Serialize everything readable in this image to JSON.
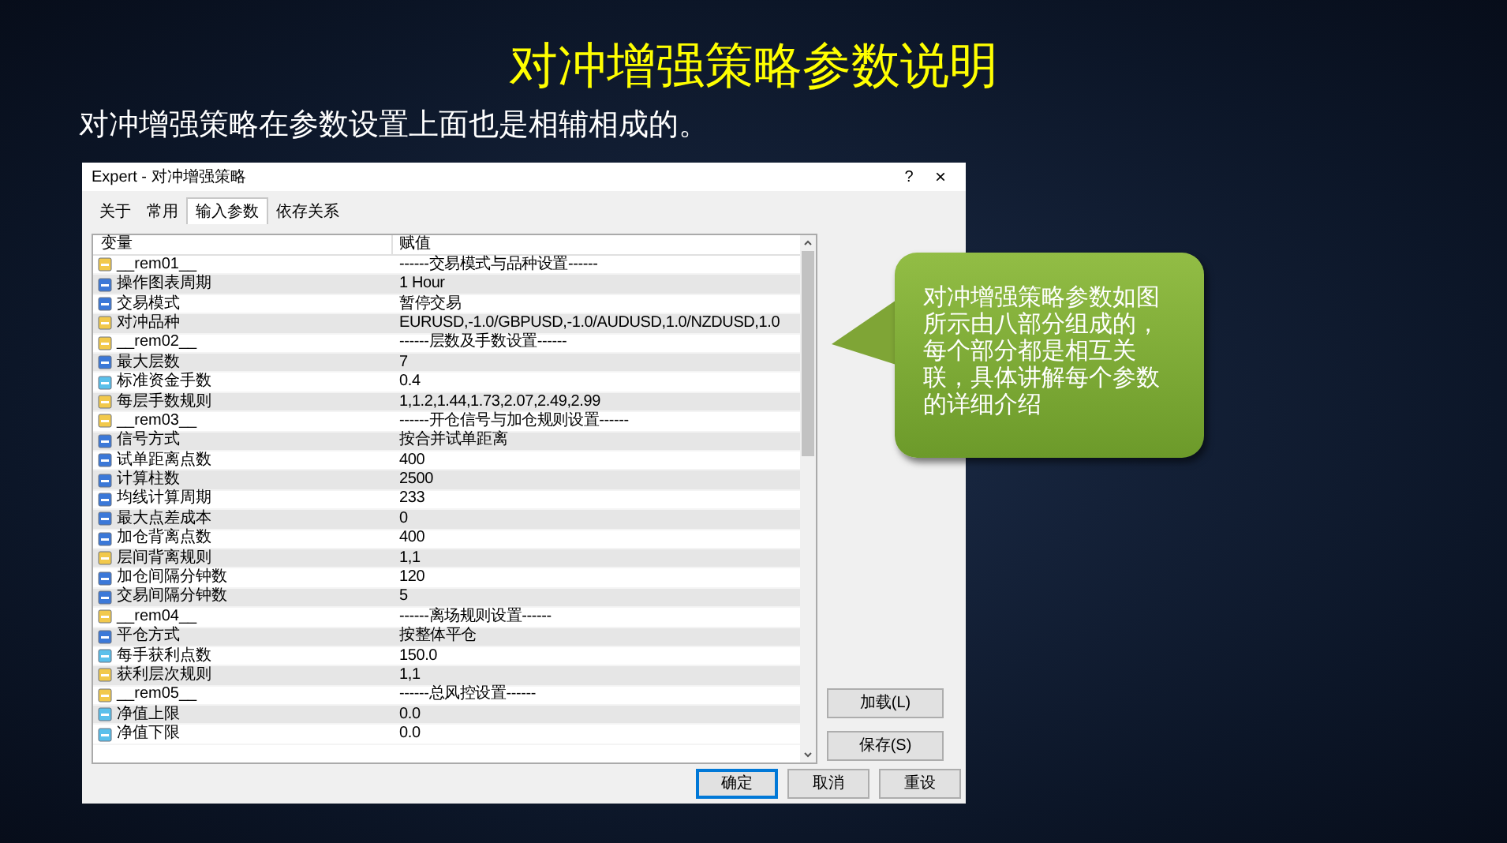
{
  "slide": {
    "title": "对冲增强策略参数说明",
    "subtitle": "对冲增强策略在参数设置上面也是相辅相成的。"
  },
  "dialog": {
    "title": "Expert - 对冲增强策略",
    "help": "?",
    "close": "×",
    "tabs": [
      {
        "label": "关于",
        "selected": false
      },
      {
        "label": "常用",
        "selected": false
      },
      {
        "label": "输入参数",
        "selected": true
      },
      {
        "label": "依存关系",
        "selected": false
      }
    ],
    "table": {
      "columns": [
        "变量",
        "赋值"
      ],
      "rows": [
        {
          "kind": "string",
          "name": "__rem01__",
          "value": "------交易模式与品种设置------"
        },
        {
          "kind": "int",
          "name": "操作图表周期",
          "value": "1 Hour"
        },
        {
          "kind": "int",
          "name": "交易模式",
          "value": "暂停交易"
        },
        {
          "kind": "string",
          "name": "对冲品种",
          "value": "EURUSD,-1.0/GBPUSD,-1.0/AUDUSD,1.0/NZDUSD,1.0"
        },
        {
          "kind": "string",
          "name": "__rem02__",
          "value": "------层数及手数设置------"
        },
        {
          "kind": "int",
          "name": "最大层数",
          "value": "7"
        },
        {
          "kind": "double",
          "name": "标准资金手数",
          "value": "0.4"
        },
        {
          "kind": "string",
          "name": "每层手数规则",
          "value": "1,1.2,1.44,1.73,2.07,2.49,2.99"
        },
        {
          "kind": "string",
          "name": "__rem03__",
          "value": "------开仓信号与加仓规则设置------"
        },
        {
          "kind": "int",
          "name": "信号方式",
          "value": "按合并试单距离"
        },
        {
          "kind": "int",
          "name": "试单距离点数",
          "value": "400"
        },
        {
          "kind": "int",
          "name": "计算柱数",
          "value": "2500"
        },
        {
          "kind": "int",
          "name": "均线计算周期",
          "value": "233"
        },
        {
          "kind": "int",
          "name": "最大点差成本",
          "value": "0"
        },
        {
          "kind": "int",
          "name": "加仓背离点数",
          "value": "400"
        },
        {
          "kind": "string",
          "name": "层间背离规则",
          "value": "1,1"
        },
        {
          "kind": "int",
          "name": "加仓间隔分钟数",
          "value": "120"
        },
        {
          "kind": "int",
          "name": "交易间隔分钟数",
          "value": "5"
        },
        {
          "kind": "string",
          "name": "__rem04__",
          "value": "------离场规则设置------"
        },
        {
          "kind": "int",
          "name": "平仓方式",
          "value": "按整体平仓"
        },
        {
          "kind": "double",
          "name": "每手获利点数",
          "value": "150.0"
        },
        {
          "kind": "string",
          "name": "获利层次规则",
          "value": "1,1"
        },
        {
          "kind": "string",
          "name": "__rem05__",
          "value": "------总风控设置------"
        },
        {
          "kind": "double",
          "name": "净值上限",
          "value": "0.0"
        },
        {
          "kind": "double",
          "name": "净值下限",
          "value": "0.0"
        }
      ]
    },
    "side_buttons": [
      "加载(L)",
      "保存(S)"
    ],
    "footer_buttons": [
      {
        "label": "确定",
        "selected": true
      },
      {
        "label": "取消",
        "selected": false
      },
      {
        "label": "重设",
        "selected": false
      }
    ]
  },
  "callout": {
    "text": "对冲增强策略参数如图所示由八部分组成的，每个部分都是相互关联，具体讲解每个参数的详细介绍"
  }
}
